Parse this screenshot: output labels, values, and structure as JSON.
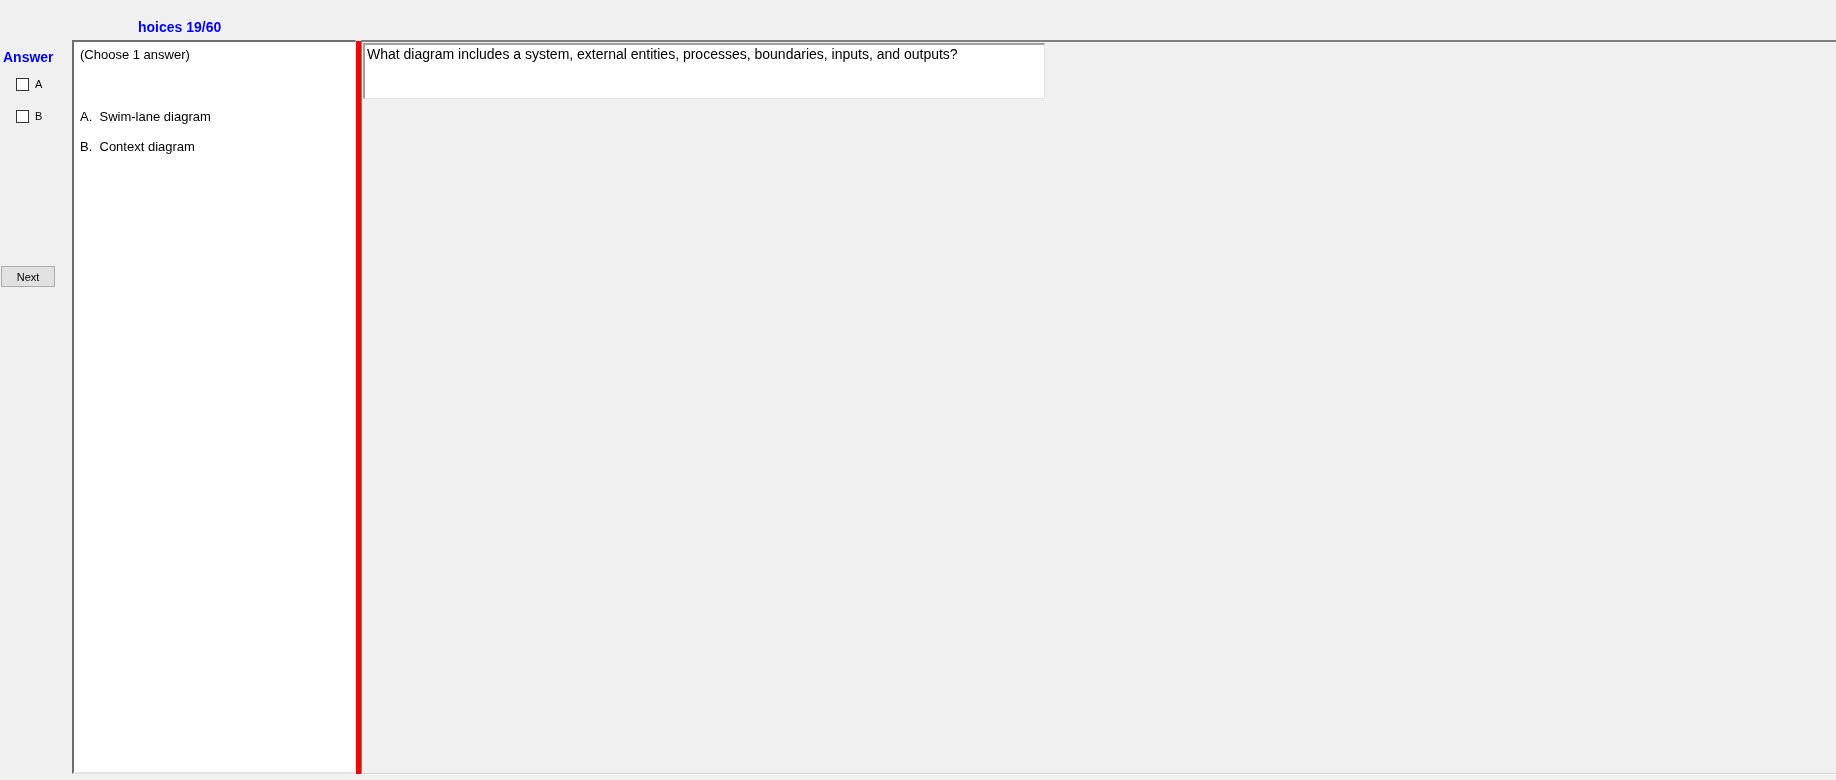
{
  "header": {
    "title": "hoices 19/60"
  },
  "answer_panel": {
    "title": "Answer",
    "options": [
      {
        "label": "A",
        "checked": false
      },
      {
        "label": "B",
        "checked": false
      }
    ],
    "next_button": "Next"
  },
  "choices_panel": {
    "instruction": "(Choose 1 answer)",
    "choices": [
      "A.  Swim-lane diagram",
      "B.  Context diagram"
    ]
  },
  "question": {
    "text": "What diagram includes a system, external entities, processes, boundaries, inputs, and outputs?"
  }
}
